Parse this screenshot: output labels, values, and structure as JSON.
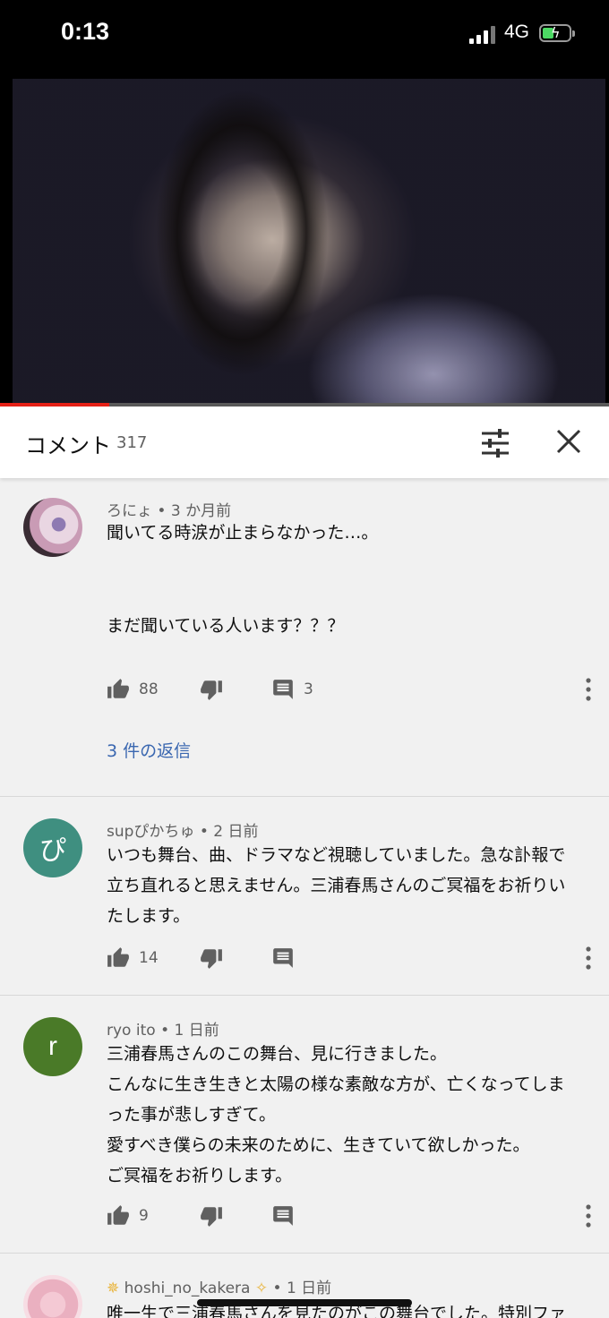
{
  "status_bar": {
    "time": "0:13",
    "network": "4G"
  },
  "video": {
    "progress": 0.18
  },
  "comments_header": {
    "title": "コメント",
    "count": "317"
  },
  "comments": [
    {
      "author": "ろにょ",
      "time": "3 か月前",
      "lines": [
        "聞いてる時涙が止まらなかった…。",
        "",
        "",
        "まだ聞いている人います？？？"
      ],
      "likes": "88",
      "reply_count": "3",
      "replies_link": "3 件の返信"
    },
    {
      "author": "supぴかちゅ",
      "time": "2 日前",
      "avatar_letter": "ぴ",
      "avatar_color": "#3f8f80",
      "lines": [
        "いつも舞台、曲、ドラマなど視聴していました。急な訃報で",
        "立ち直れると思えません。三浦春馬さんのご冥福をお祈りい",
        "たします。"
      ],
      "likes": "14"
    },
    {
      "author": "ryo ito",
      "time": "1 日前",
      "avatar_letter": "r",
      "avatar_color": "#4a7a28",
      "lines": [
        "三浦春馬さんのこの舞台、見に行きました。",
        "こんなに生き生きと太陽の様な素敵な方が、亡くなってしま",
        "った事が悲しすぎて。",
        "愛すべき僕らの未来のために、生きていて欲しかった。",
        "ご冥福をお祈りします。"
      ],
      "likes": "9"
    },
    {
      "author": "hoshi_no_kakera",
      "time": "1 日前",
      "lines": [
        "唯一生で三浦春馬さんを見たのがこの舞台でした。特別ファ"
      ]
    }
  ],
  "separator": "•"
}
